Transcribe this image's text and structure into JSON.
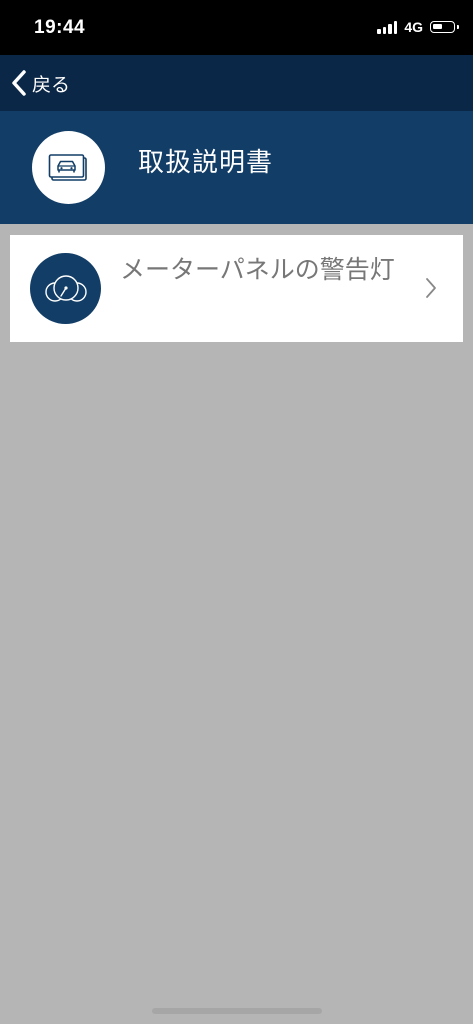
{
  "status_bar": {
    "time": "19:44",
    "network": "4G",
    "battery_level_fraction": 0.5
  },
  "nav": {
    "back_label": "戻る",
    "back_icon": "chevron-left-icon"
  },
  "header": {
    "title": "取扱説明書",
    "icon": "manual-car-icon"
  },
  "list": {
    "items": [
      {
        "label": "メーターパネルの警告灯",
        "icon": "gauge-icon",
        "chevron_icon": "chevron-right-icon"
      }
    ]
  },
  "colors": {
    "status_bar_bg": "#000000",
    "nav_bg": "#0b2747",
    "header_bg": "#123d66",
    "page_bg": "#b5b5b5",
    "item_label": "#777777"
  }
}
